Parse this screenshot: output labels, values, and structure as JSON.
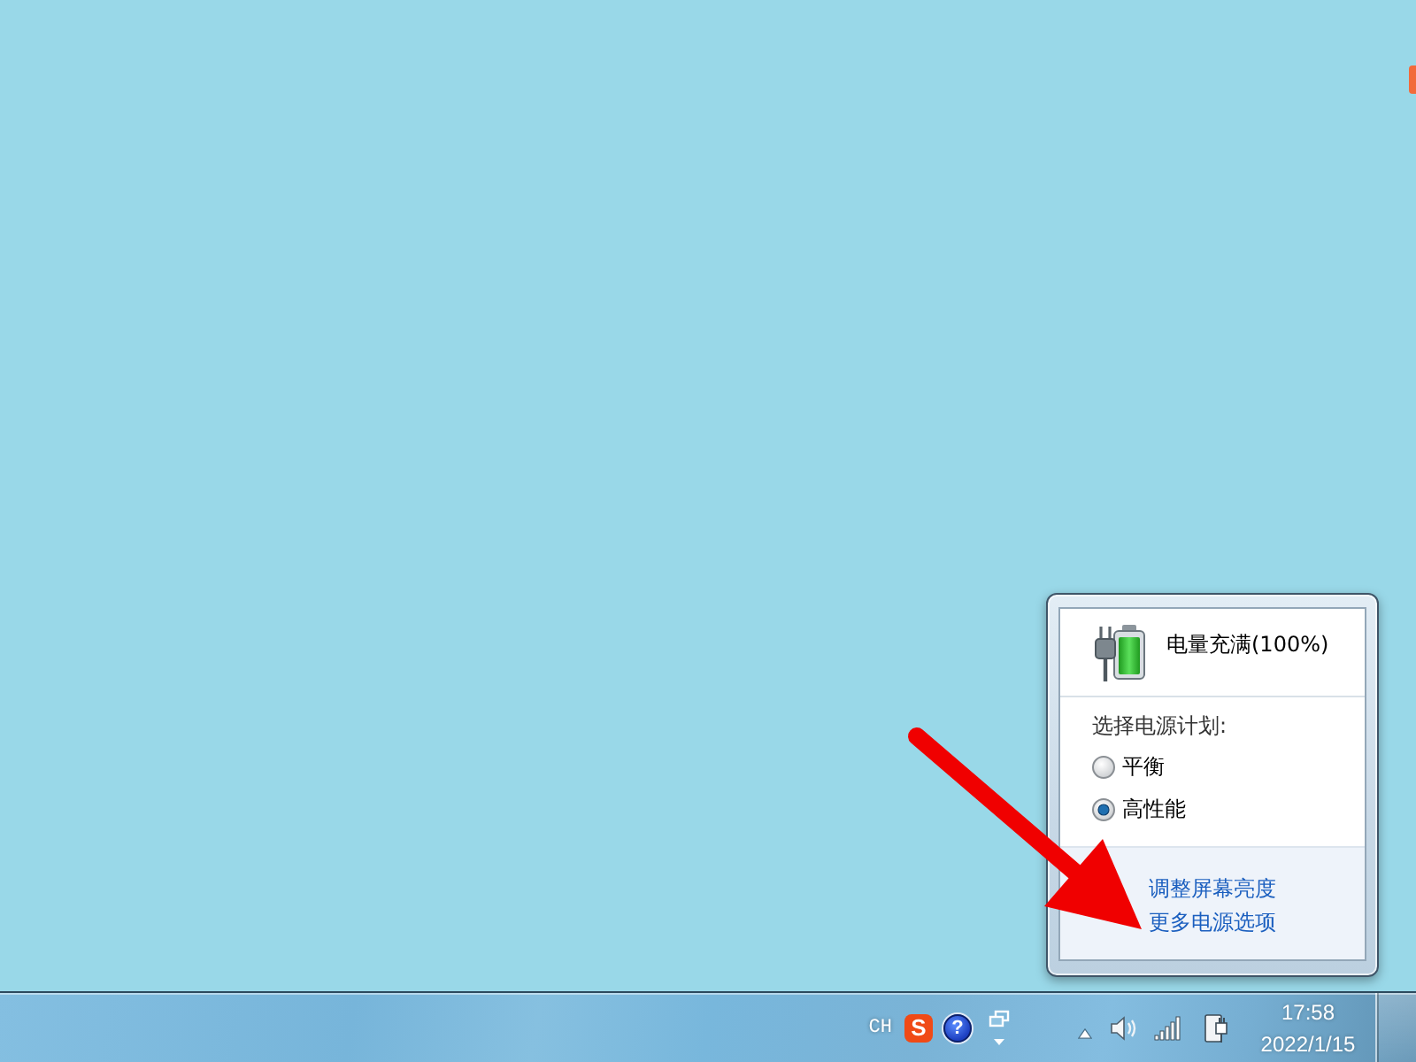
{
  "power_popup": {
    "status": "电量充满(100%)",
    "plan_heading": "选择电源计划:",
    "plans": [
      {
        "label": "平衡",
        "selected": false
      },
      {
        "label": "高性能",
        "selected": true
      }
    ],
    "links": [
      "调整屏幕亮度",
      "更多电源选项"
    ]
  },
  "taskbar": {
    "language": "CH",
    "ime_logo": "S",
    "help_icon": "?",
    "clock": {
      "time": "17:58",
      "date": "2022/1/15"
    }
  }
}
